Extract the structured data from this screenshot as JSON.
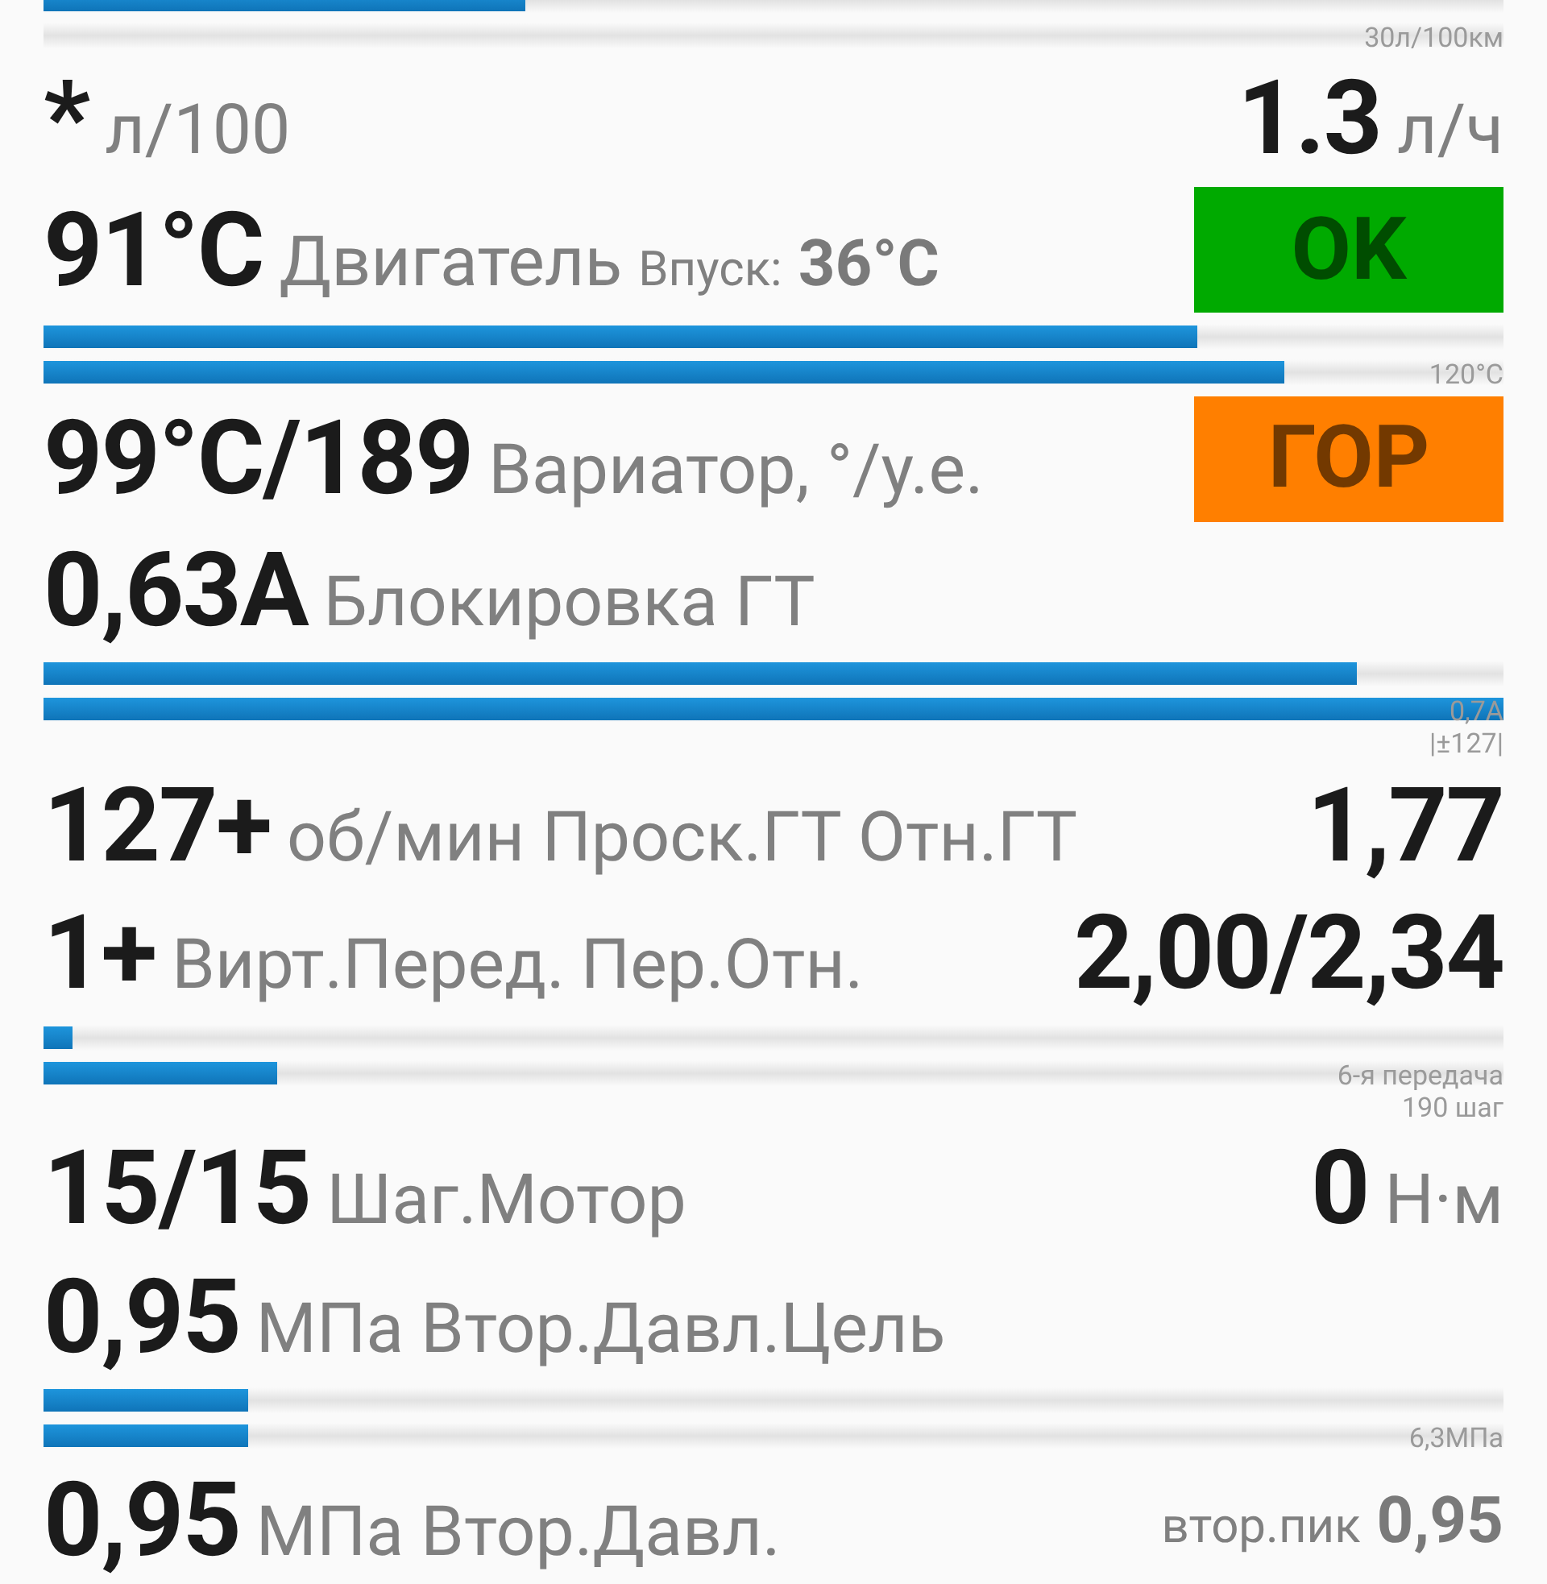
{
  "sections": [
    {
      "kind": "bars",
      "bars": [
        {
          "kind": "filled",
          "level": 0.33
        },
        {
          "kind": "empty"
        }
      ],
      "labels": [
        "30л/100км"
      ]
    },
    {
      "kind": "row",
      "left": [
        {
          "kind": "value",
          "text": "*"
        },
        {
          "kind": "unit",
          "text": "л/100"
        }
      ],
      "right": [
        {
          "kind": "value",
          "text": "1.3"
        },
        {
          "kind": "unit",
          "text": "л/ч"
        }
      ]
    },
    {
      "kind": "row",
      "left": [
        {
          "kind": "value",
          "text": "91°C"
        },
        {
          "kind": "unit",
          "text": "Двигатель"
        },
        {
          "kind": "small_label",
          "text": "Впуск:"
        },
        {
          "kind": "small_value",
          "text": "36°C"
        }
      ],
      "badge": {
        "text": "OK",
        "color": "#00aa00"
      }
    },
    {
      "kind": "bars",
      "bars": [
        {
          "level": 0.79
        },
        {
          "level": 0.85
        }
      ],
      "labels": [
        "120°C"
      ]
    },
    {
      "kind": "row",
      "left": [
        {
          "kind": "value",
          "text": "99°C/189"
        },
        {
          "kind": "unit",
          "text": "Вариатор, °/у.е."
        }
      ],
      "badge": {
        "text": "ГОР",
        "color": "#ff7f00"
      }
    },
    {
      "kind": "row",
      "left": [
        {
          "kind": "value",
          "text": "0,63А"
        },
        {
          "kind": "unit",
          "text": "Блокировка ГТ"
        }
      ]
    },
    {
      "kind": "bars",
      "bars": [
        {
          "level": 0.9
        },
        {
          "level": 1
        }
      ],
      "labels": [
        "0,7А",
        "|±127|"
      ]
    },
    {
      "kind": "row",
      "left": [
        {
          "kind": "value",
          "text": "127+"
        },
        {
          "kind": "unit",
          "text": "об/мин Проск.ГТ"
        },
        {
          "kind": "unit",
          "text": "Отн.ГТ"
        }
      ],
      "right": [
        {
          "kind": "value",
          "text": "1,77"
        }
      ]
    },
    {
      "kind": "row",
      "left": [
        {
          "kind": "value",
          "text": "1+"
        },
        {
          "kind": "unit",
          "text": "Вирт.Перед."
        },
        {
          "kind": "unit",
          "text": "Пер.Отн."
        }
      ],
      "right": [
        {
          "kind": "value",
          "text": "2,00/2,34"
        }
      ]
    },
    {
      "kind": "bars",
      "bars": [
        {
          "level": 0.02
        },
        {
          "level": 0.16
        }
      ],
      "labels": [
        "6-я передача",
        "190 шаг"
      ]
    },
    {
      "kind": "row",
      "left": [
        {
          "kind": "value",
          "text": "15/15"
        },
        {
          "kind": "unit",
          "text": "Шаг.Мотор"
        }
      ],
      "right": [
        {
          "kind": "value",
          "text": "0"
        },
        {
          "kind": "unit",
          "text": "Н·м"
        }
      ]
    },
    {
      "kind": "row",
      "left": [
        {
          "kind": "value",
          "text": "0,95"
        },
        {
          "kind": "unit",
          "text": "МПа Втор.Давл.Цель"
        }
      ]
    },
    {
      "kind": "bars",
      "bars": [
        {
          "level": 0.14
        },
        {
          "level": 0.14
        }
      ],
      "labels": [
        "6,3МПа"
      ]
    },
    {
      "kind": "row",
      "left": [
        {
          "kind": "value",
          "text": "0,95"
        },
        {
          "kind": "unit",
          "text": "МПа Втор.Давл."
        }
      ],
      "right": [
        {
          "kind": "small_label",
          "text": "втор.пик"
        },
        {
          "kind": "small_value",
          "text": "0,95"
        }
      ]
    }
  ]
}
